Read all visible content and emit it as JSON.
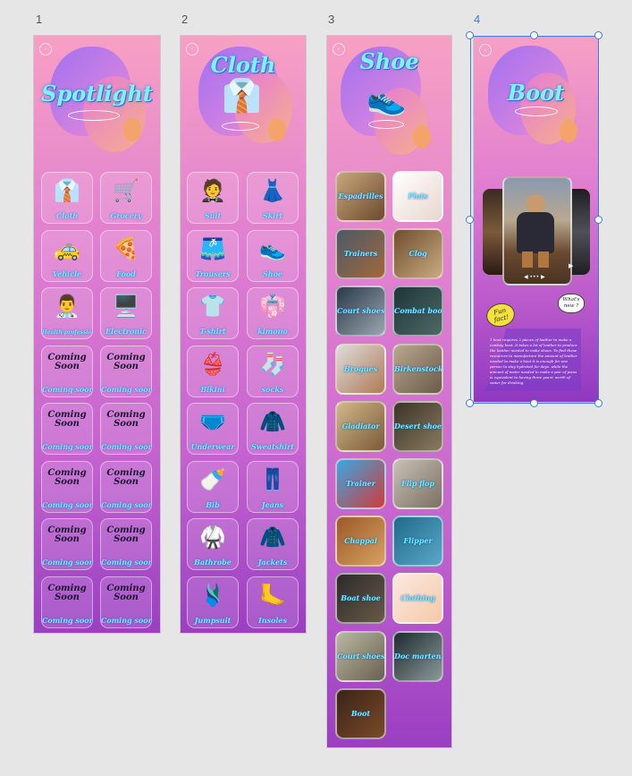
{
  "screens": {
    "s1": {
      "number": "1",
      "title": "Spotlight"
    },
    "s2": {
      "number": "2",
      "title": "Cloth"
    },
    "s3": {
      "number": "3",
      "title": "Shoe"
    },
    "s4": {
      "number": "4",
      "title": "Boot"
    }
  },
  "spotlight_tiles": [
    {
      "label": "Cloth",
      "icon": "👔"
    },
    {
      "label": "Grocery",
      "icon": "🛒"
    },
    {
      "label": "Vehicle",
      "icon": "🚕"
    },
    {
      "label": "Food",
      "icon": "🍕"
    },
    {
      "label": "Health professionals",
      "icon": "👨‍⚕️"
    },
    {
      "label": "Electronic",
      "icon": "🖥️"
    },
    {
      "label": "Coming soon",
      "caption": "Coming Soon"
    },
    {
      "label": "Coming soon",
      "caption": "Coming Soon"
    },
    {
      "label": "Coming soon",
      "caption": "Coming Soon"
    },
    {
      "label": "Coming soon",
      "caption": "Coming Soon"
    },
    {
      "label": "Coming soon",
      "caption": "Coming Soon"
    },
    {
      "label": "Coming soon",
      "caption": "Coming Soon"
    },
    {
      "label": "Coming soon",
      "caption": "Coming Soon"
    },
    {
      "label": "Coming soon",
      "caption": "Coming Soon"
    },
    {
      "label": "Coming soon",
      "caption": "Coming Soon"
    },
    {
      "label": "Coming soon",
      "caption": "Coming Soon"
    }
  ],
  "cloth_tiles": [
    {
      "label": "Suit",
      "icon": "🤵"
    },
    {
      "label": "Skirt",
      "icon": "👗"
    },
    {
      "label": "Trousers",
      "icon": "🩳"
    },
    {
      "label": "Shoe",
      "icon": "👟"
    },
    {
      "label": "T-shirt",
      "icon": "👕"
    },
    {
      "label": "kimono",
      "icon": "👘"
    },
    {
      "label": "Bikini",
      "icon": "👙"
    },
    {
      "label": "socks",
      "icon": "🧦"
    },
    {
      "label": "Underwear",
      "icon": "🩲"
    },
    {
      "label": "Sweatshirt",
      "icon": "🧥"
    },
    {
      "label": "Bib",
      "icon": "🍼"
    },
    {
      "label": "Jeans",
      "icon": "👖"
    },
    {
      "label": "Bathrobe",
      "icon": "🥋"
    },
    {
      "label": "Jackets",
      "icon": "🧥"
    },
    {
      "label": "Jumpsuit",
      "icon": "🩱"
    },
    {
      "label": "Insoles",
      "icon": "🦶"
    }
  ],
  "shoe_tiles": [
    {
      "label": "Espadrilles",
      "c1": "#c9a77b",
      "c2": "#6b4a2e"
    },
    {
      "label": "Flats",
      "c1": "#ffffff",
      "c2": "#e8d6cf"
    },
    {
      "label": "Trainers",
      "c1": "#4a5a6a",
      "c2": "#a2683a"
    },
    {
      "label": "Clog",
      "c1": "#6e4e2e",
      "c2": "#c9ab80"
    },
    {
      "label": "Court shoes",
      "c1": "#2a3a4a",
      "c2": "#9aa5ae"
    },
    {
      "label": "Combat boots",
      "c1": "#1e3438",
      "c2": "#4d6a66"
    },
    {
      "label": "Brogues",
      "c1": "#dcdcdc",
      "c2": "#b07a55"
    },
    {
      "label": "Birkenstock",
      "c1": "#b8a890",
      "c2": "#6a5a48"
    },
    {
      "label": "Gladiator",
      "c1": "#d0b888",
      "c2": "#7a5a38"
    },
    {
      "label": "Desert shoe",
      "c1": "#3a3428",
      "c2": "#8a7a60"
    },
    {
      "label": "Trainer",
      "c1": "#38a8e0",
      "c2": "#d23a3a"
    },
    {
      "label": "Flip flop",
      "c1": "#c8c0b4",
      "c2": "#7a7064"
    },
    {
      "label": "Chappal",
      "c1": "#9a5a28",
      "c2": "#d9a060"
    },
    {
      "label": "Flipper",
      "c1": "#1e6a8a",
      "c2": "#5aa8c8"
    },
    {
      "label": "Boat shoe",
      "c1": "#2a2a2a",
      "c2": "#6a5a48"
    },
    {
      "label": "Clothing",
      "c1": "#fbe8e0",
      "c2": "#f5c9a8"
    },
    {
      "label": "Court shoes",
      "c1": "#b8b8a0",
      "c2": "#6a6050"
    },
    {
      "label": "Doc martens",
      "c1": "#1e2a30",
      "c2": "#8a9a98"
    },
    {
      "label": "Boot",
      "c1": "#3a2418",
      "c2": "#7a4a28"
    }
  ],
  "boot_screen": {
    "fun_fact_badge": "Fun fact!",
    "whats_new_badge": "What's new ?",
    "fact_text": "1 boot requires 2 pieces of leather to make a cowboy boot. It takes a lot of leather to produce the leather needed to make shoes. To find these resources to manufacture the amount of leather needed to make a boot it is enough for one person to stay hydrated for days. while the amount of water needed to make a pair of jeans is equivalent to having three years' worth of water for drinking."
  },
  "colors": {
    "title": "#7df3ff",
    "selection": "#3c7be0",
    "background": "#e6e6e6"
  }
}
